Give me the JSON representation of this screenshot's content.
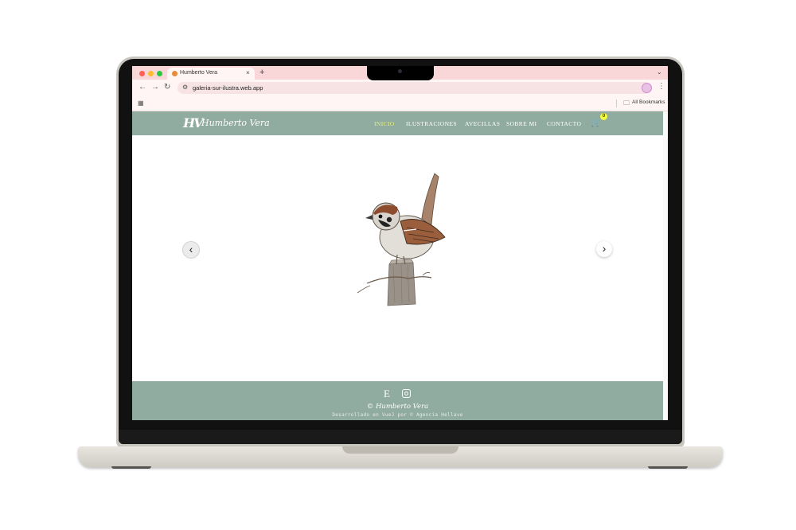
{
  "browser": {
    "tab_title": "Humberto Vera",
    "tab_close": "×",
    "new_tab": "+",
    "url": "galeria-sur-ilustra.web.app",
    "bookmarks_label": "All Bookmarks",
    "icons": [
      "back-icon",
      "forward-icon",
      "reload-icon",
      "site-settings-icon",
      "star-icon",
      "profile-icon",
      "menu-icon",
      "apps-icon",
      "folder-icon"
    ]
  },
  "site": {
    "logo_monogram": "HV",
    "logo_text": "Humberto Vera",
    "nav": [
      {
        "label": "INICIO",
        "active": true
      },
      {
        "label": "ILUSTRACIONES",
        "active": false
      },
      {
        "label": "AVECILLAS",
        "active": false
      },
      {
        "label": "SOBRE MI",
        "active": false
      },
      {
        "label": "CONTACTO",
        "active": false
      }
    ],
    "cart_count": "0",
    "prev_arrow": "‹",
    "next_arrow": "›",
    "hero_image": "sparrow-illustration",
    "footer": {
      "etsy": "E",
      "copyright": "© Humberto Vera",
      "developer": "Desarrollado en VueJ por © Agencia Hellave"
    },
    "colors": {
      "header_bg": "#90ab9f",
      "active_nav": "#e5f27c",
      "cart_badge": "#f3ff3d",
      "tabbar_bg": "#f9d7d8"
    }
  }
}
